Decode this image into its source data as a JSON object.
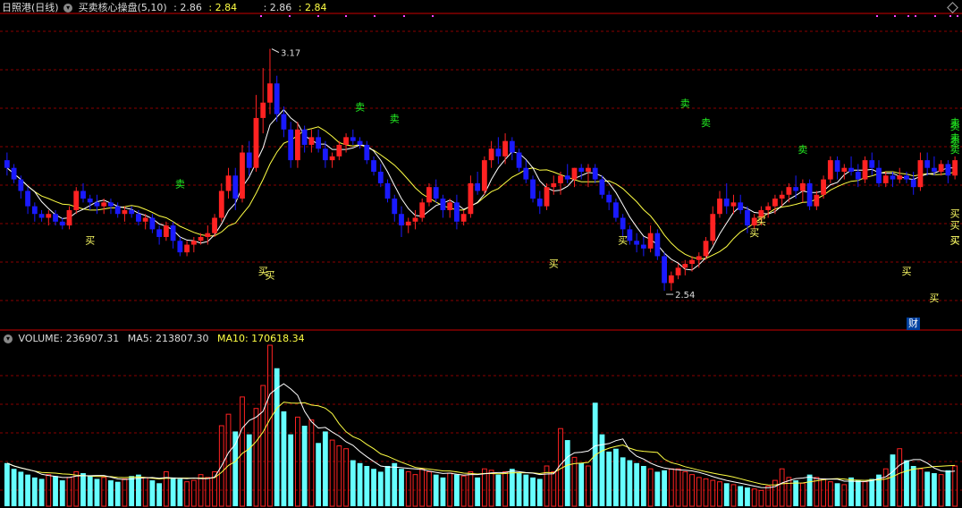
{
  "header": {
    "stock_name": "日照港(日线)",
    "indicator_name": "买卖核心操盘(5,10)",
    "val1_label": ": 2.86",
    "val2_label": ": 2.84",
    "val3_label": ": 2.86",
    "val4_label": ": 2.84",
    "chevron_icon": "chevron-down-icon"
  },
  "volume_header": {
    "volume": "VOLUME: 236907.31",
    "ma5": "MA5: 213807.30",
    "ma10": "MA10: 170618.34"
  },
  "cai_badge": "财",
  "colors": {
    "up": "#ff2222",
    "down": "#1a1aff",
    "vol_down": "#66ffff",
    "ma_white": "#ffffff",
    "ma_yellow": "#ffff44",
    "sell_signal": "#22ee22",
    "buy_signal": "#ffff66",
    "grid": "#8a0000"
  },
  "chart_data": {
    "type": "candlestick",
    "price_axis": {
      "ymin": 2.44,
      "ymax": 3.26
    },
    "max_price_label": "3.17",
    "min_price_label": "2.54",
    "candles": [
      [
        2.88,
        2.9,
        2.84,
        2.86
      ],
      [
        2.86,
        2.87,
        2.82,
        2.83
      ],
      [
        2.83,
        2.84,
        2.78,
        2.8
      ],
      [
        2.8,
        2.81,
        2.74,
        2.76
      ],
      [
        2.76,
        2.77,
        2.72,
        2.74
      ],
      [
        2.74,
        2.75,
        2.72,
        2.73
      ],
      [
        2.73,
        2.75,
        2.71,
        2.74
      ],
      [
        2.74,
        2.75,
        2.71,
        2.72
      ],
      [
        2.72,
        2.73,
        2.7,
        2.71
      ],
      [
        2.71,
        2.76,
        2.7,
        2.75
      ],
      [
        2.75,
        2.81,
        2.74,
        2.8
      ],
      [
        2.8,
        2.82,
        2.77,
        2.78
      ],
      [
        2.78,
        2.79,
        2.75,
        2.77
      ],
      [
        2.77,
        2.79,
        2.74,
        2.76
      ],
      [
        2.76,
        2.78,
        2.74,
        2.77
      ],
      [
        2.77,
        2.78,
        2.74,
        2.76
      ],
      [
        2.76,
        2.77,
        2.73,
        2.74
      ],
      [
        2.74,
        2.76,
        2.72,
        2.75
      ],
      [
        2.75,
        2.76,
        2.73,
        2.74
      ],
      [
        2.74,
        2.75,
        2.71,
        2.72
      ],
      [
        2.72,
        2.74,
        2.7,
        2.73
      ],
      [
        2.73,
        2.74,
        2.69,
        2.7
      ],
      [
        2.7,
        2.71,
        2.66,
        2.68
      ],
      [
        2.68,
        2.72,
        2.67,
        2.71
      ],
      [
        2.71,
        2.72,
        2.65,
        2.67
      ],
      [
        2.67,
        2.68,
        2.63,
        2.64
      ],
      [
        2.64,
        2.67,
        2.63,
        2.66
      ],
      [
        2.66,
        2.68,
        2.64,
        2.67
      ],
      [
        2.67,
        2.69,
        2.66,
        2.68
      ],
      [
        2.68,
        2.71,
        2.66,
        2.69
      ],
      [
        2.69,
        2.74,
        2.68,
        2.73
      ],
      [
        2.73,
        2.82,
        2.72,
        2.8
      ],
      [
        2.8,
        2.86,
        2.78,
        2.84
      ],
      [
        2.84,
        2.86,
        2.75,
        2.78
      ],
      [
        2.78,
        2.92,
        2.77,
        2.9
      ],
      [
        2.9,
        2.93,
        2.84,
        2.86
      ],
      [
        2.86,
        3.05,
        2.85,
        2.99
      ],
      [
        2.99,
        3.12,
        2.95,
        3.03
      ],
      [
        3.03,
        3.17,
        3.0,
        3.08
      ],
      [
        3.08,
        3.1,
        2.98,
        3.0
      ],
      [
        3.0,
        3.02,
        2.94,
        2.96
      ],
      [
        2.96,
        2.98,
        2.86,
        2.88
      ],
      [
        2.88,
        2.98,
        2.86,
        2.96
      ],
      [
        2.96,
        2.97,
        2.9,
        2.92
      ],
      [
        2.92,
        2.96,
        2.9,
        2.94
      ],
      [
        2.94,
        2.96,
        2.9,
        2.91
      ],
      [
        2.91,
        2.93,
        2.86,
        2.88
      ],
      [
        2.88,
        2.9,
        2.86,
        2.89
      ],
      [
        2.89,
        2.93,
        2.88,
        2.92
      ],
      [
        2.92,
        2.95,
        2.9,
        2.94
      ],
      [
        2.94,
        2.96,
        2.92,
        2.93
      ],
      [
        2.93,
        2.94,
        2.91,
        2.92
      ],
      [
        2.92,
        2.93,
        2.87,
        2.88
      ],
      [
        2.88,
        2.89,
        2.84,
        2.85
      ],
      [
        2.85,
        2.87,
        2.81,
        2.82
      ],
      [
        2.82,
        2.83,
        2.77,
        2.78
      ],
      [
        2.78,
        2.79,
        2.72,
        2.74
      ],
      [
        2.74,
        2.76,
        2.68,
        2.71
      ],
      [
        2.71,
        2.73,
        2.69,
        2.72
      ],
      [
        2.72,
        2.75,
        2.7,
        2.73
      ],
      [
        2.73,
        2.78,
        2.72,
        2.77
      ],
      [
        2.77,
        2.82,
        2.76,
        2.81
      ],
      [
        2.81,
        2.83,
        2.77,
        2.78
      ],
      [
        2.78,
        2.79,
        2.73,
        2.75
      ],
      [
        2.75,
        2.78,
        2.73,
        2.77
      ],
      [
        2.77,
        2.79,
        2.7,
        2.72
      ],
      [
        2.72,
        2.75,
        2.71,
        2.74
      ],
      [
        2.74,
        2.84,
        2.73,
        2.82
      ],
      [
        2.82,
        2.85,
        2.79,
        2.8
      ],
      [
        2.8,
        2.89,
        2.79,
        2.88
      ],
      [
        2.88,
        2.93,
        2.86,
        2.91
      ],
      [
        2.91,
        2.94,
        2.87,
        2.89
      ],
      [
        2.89,
        2.95,
        2.87,
        2.93
      ],
      [
        2.93,
        2.94,
        2.88,
        2.9
      ],
      [
        2.9,
        2.91,
        2.85,
        2.86
      ],
      [
        2.86,
        2.88,
        2.82,
        2.83
      ],
      [
        2.83,
        2.84,
        2.77,
        2.78
      ],
      [
        2.78,
        2.8,
        2.74,
        2.76
      ],
      [
        2.76,
        2.82,
        2.75,
        2.81
      ],
      [
        2.81,
        2.84,
        2.79,
        2.82
      ],
      [
        2.82,
        2.85,
        2.79,
        2.84
      ],
      [
        2.84,
        2.87,
        2.82,
        2.83
      ],
      [
        2.83,
        2.86,
        2.81,
        2.86
      ],
      [
        2.86,
        2.87,
        2.83,
        2.85
      ],
      [
        2.85,
        2.87,
        2.81,
        2.86
      ],
      [
        2.86,
        2.87,
        2.82,
        2.83
      ],
      [
        2.83,
        2.84,
        2.78,
        2.79
      ],
      [
        2.79,
        2.8,
        2.75,
        2.77
      ],
      [
        2.77,
        2.78,
        2.72,
        2.73
      ],
      [
        2.73,
        2.74,
        2.68,
        2.7
      ],
      [
        2.7,
        2.71,
        2.66,
        2.67
      ],
      [
        2.67,
        2.69,
        2.64,
        2.66
      ],
      [
        2.66,
        2.68,
        2.63,
        2.65
      ],
      [
        2.65,
        2.71,
        2.64,
        2.69
      ],
      [
        2.69,
        2.7,
        2.62,
        2.63
      ],
      [
        2.63,
        2.64,
        2.54,
        2.56
      ],
      [
        2.56,
        2.59,
        2.54,
        2.58
      ],
      [
        2.58,
        2.61,
        2.57,
        2.6
      ],
      [
        2.6,
        2.62,
        2.58,
        2.61
      ],
      [
        2.61,
        2.63,
        2.59,
        2.62
      ],
      [
        2.62,
        2.64,
        2.6,
        2.63
      ],
      [
        2.63,
        2.68,
        2.62,
        2.67
      ],
      [
        2.67,
        2.76,
        2.66,
        2.74
      ],
      [
        2.74,
        2.8,
        2.73,
        2.78
      ],
      [
        2.78,
        2.82,
        2.74,
        2.76
      ],
      [
        2.76,
        2.79,
        2.74,
        2.77
      ],
      [
        2.77,
        2.79,
        2.74,
        2.75
      ],
      [
        2.75,
        2.76,
        2.69,
        2.71
      ],
      [
        2.71,
        2.74,
        2.7,
        2.73
      ],
      [
        2.73,
        2.76,
        2.71,
        2.75
      ],
      [
        2.75,
        2.77,
        2.73,
        2.76
      ],
      [
        2.76,
        2.79,
        2.74,
        2.78
      ],
      [
        2.78,
        2.8,
        2.76,
        2.79
      ],
      [
        2.79,
        2.82,
        2.77,
        2.81
      ],
      [
        2.81,
        2.84,
        2.78,
        2.8
      ],
      [
        2.8,
        2.83,
        2.77,
        2.82
      ],
      [
        2.82,
        2.83,
        2.75,
        2.76
      ],
      [
        2.76,
        2.8,
        2.75,
        2.79
      ],
      [
        2.79,
        2.84,
        2.78,
        2.83
      ],
      [
        2.83,
        2.89,
        2.82,
        2.88
      ],
      [
        2.88,
        2.89,
        2.83,
        2.85
      ],
      [
        2.85,
        2.87,
        2.83,
        2.86
      ],
      [
        2.86,
        2.89,
        2.84,
        2.85
      ],
      [
        2.85,
        2.87,
        2.81,
        2.83
      ],
      [
        2.83,
        2.89,
        2.82,
        2.88
      ],
      [
        2.88,
        2.9,
        2.84,
        2.86
      ],
      [
        2.86,
        2.88,
        2.81,
        2.82
      ],
      [
        2.82,
        2.85,
        2.81,
        2.84
      ],
      [
        2.84,
        2.85,
        2.81,
        2.83
      ],
      [
        2.83,
        2.86,
        2.82,
        2.84
      ],
      [
        2.84,
        2.85,
        2.82,
        2.83
      ],
      [
        2.83,
        2.85,
        2.79,
        2.81
      ],
      [
        2.81,
        2.9,
        2.8,
        2.88
      ],
      [
        2.88,
        2.9,
        2.84,
        2.86
      ],
      [
        2.86,
        2.89,
        2.84,
        2.85
      ],
      [
        2.85,
        2.88,
        2.84,
        2.87
      ],
      [
        2.87,
        2.88,
        2.82,
        2.84
      ],
      [
        2.84,
        2.89,
        2.83,
        2.88
      ]
    ],
    "signals": [
      {
        "type": "buy",
        "label": "买",
        "index": 12,
        "price": 2.69
      },
      {
        "type": "sell",
        "label": "卖",
        "index": 25,
        "price": 2.8
      },
      {
        "type": "buy",
        "label": "买",
        "index": 37,
        "price": 2.61
      },
      {
        "type": "buy",
        "label": "买",
        "index": 38,
        "price": 2.6
      },
      {
        "type": "sell",
        "label": "卖",
        "index": 51,
        "price": 3.0
      },
      {
        "type": "sell",
        "label": "卖",
        "index": 56,
        "price": 2.97
      },
      {
        "type": "buy",
        "label": "买",
        "index": 79,
        "price": 2.63
      },
      {
        "type": "buy",
        "label": "买",
        "index": 89,
        "price": 2.69
      },
      {
        "type": "sell",
        "label": "卖",
        "index": 98,
        "price": 3.01
      },
      {
        "type": "sell",
        "label": "卖",
        "index": 101,
        "price": 2.96
      },
      {
        "type": "buy",
        "label": "买",
        "index": 108,
        "price": 2.71
      },
      {
        "type": "buy",
        "label": "买",
        "index": 109,
        "price": 2.74
      },
      {
        "type": "sell",
        "label": "卖",
        "index": 115,
        "price": 2.89
      },
      {
        "type": "buy",
        "label": "买",
        "index": 130,
        "price": 2.61
      },
      {
        "type": "buy",
        "label": "买",
        "index": 134,
        "price": 2.54
      },
      {
        "type": "sell",
        "label": "卖",
        "index": 153,
        "price": 2.89
      },
      {
        "type": "buy",
        "label": "买",
        "index": 156,
        "price": 2.69
      },
      {
        "type": "sell",
        "label": "卖",
        "index": 163,
        "price": 2.92
      },
      {
        "type": "sell",
        "label": "卖",
        "index": 166,
        "price": 2.96
      },
      {
        "type": "sell",
        "label": "卖",
        "index": 168,
        "price": 2.91
      },
      {
        "type": "buy",
        "label": "买",
        "index": 164,
        "price": 2.73
      },
      {
        "type": "buy",
        "label": "买",
        "index": 174,
        "price": 2.69
      },
      {
        "type": "sell",
        "label": "卖",
        "index": 178,
        "price": 2.95
      },
      {
        "type": "buy",
        "label": "买",
        "index": 179,
        "price": 2.76
      }
    ],
    "volume_axis": {
      "ymin": 0,
      "ymax": 560000
    },
    "volume": [
      150000,
      130000,
      120000,
      110000,
      100000,
      95000,
      110000,
      105000,
      90000,
      100000,
      120000,
      115000,
      105000,
      95000,
      100000,
      90000,
      85000,
      95000,
      105000,
      110000,
      100000,
      90000,
      80000,
      120000,
      100000,
      95000,
      85000,
      90000,
      110000,
      100000,
      120000,
      280000,
      320000,
      260000,
      380000,
      250000,
      340000,
      420000,
      560000,
      480000,
      330000,
      250000,
      310000,
      280000,
      300000,
      220000,
      260000,
      230000,
      210000,
      200000,
      160000,
      150000,
      140000,
      130000,
      120000,
      140000,
      150000,
      130000,
      120000,
      110000,
      130000,
      120000,
      110000,
      100000,
      115000,
      110000,
      105000,
      120000,
      100000,
      130000,
      125000,
      110000,
      120000,
      130000,
      115000,
      110000,
      100000,
      95000,
      140000,
      120000,
      270000,
      230000,
      170000,
      150000,
      140000,
      360000,
      250000,
      190000,
      200000,
      170000,
      160000,
      150000,
      140000,
      130000,
      120000,
      125000,
      130000,
      130000,
      120000,
      110000,
      100000,
      95000,
      90000,
      85000,
      80000,
      75000,
      70000,
      65000,
      60000,
      55000,
      70000,
      90000,
      130000,
      100000,
      90000,
      80000,
      110000,
      100000,
      95000,
      85000,
      80000,
      75000,
      100000,
      90000,
      85000,
      95000,
      110000,
      130000,
      180000,
      200000,
      160000,
      140000,
      130000,
      120000,
      115000,
      110000,
      125000,
      140000,
      120000,
      115000,
      110000,
      120000,
      130000,
      140000,
      125000,
      110000,
      100000,
      115000,
      120000,
      130000,
      125000,
      135000,
      140000,
      150000,
      160000,
      130000,
      120000,
      140000,
      120000,
      110000,
      110000,
      130000,
      120000,
      140000,
      150000,
      125000,
      130000,
      120000,
      110000,
      115000,
      140000,
      125000,
      150000,
      200000,
      236907,
      185000,
      120000,
      140000,
      110000,
      170000
    ]
  }
}
